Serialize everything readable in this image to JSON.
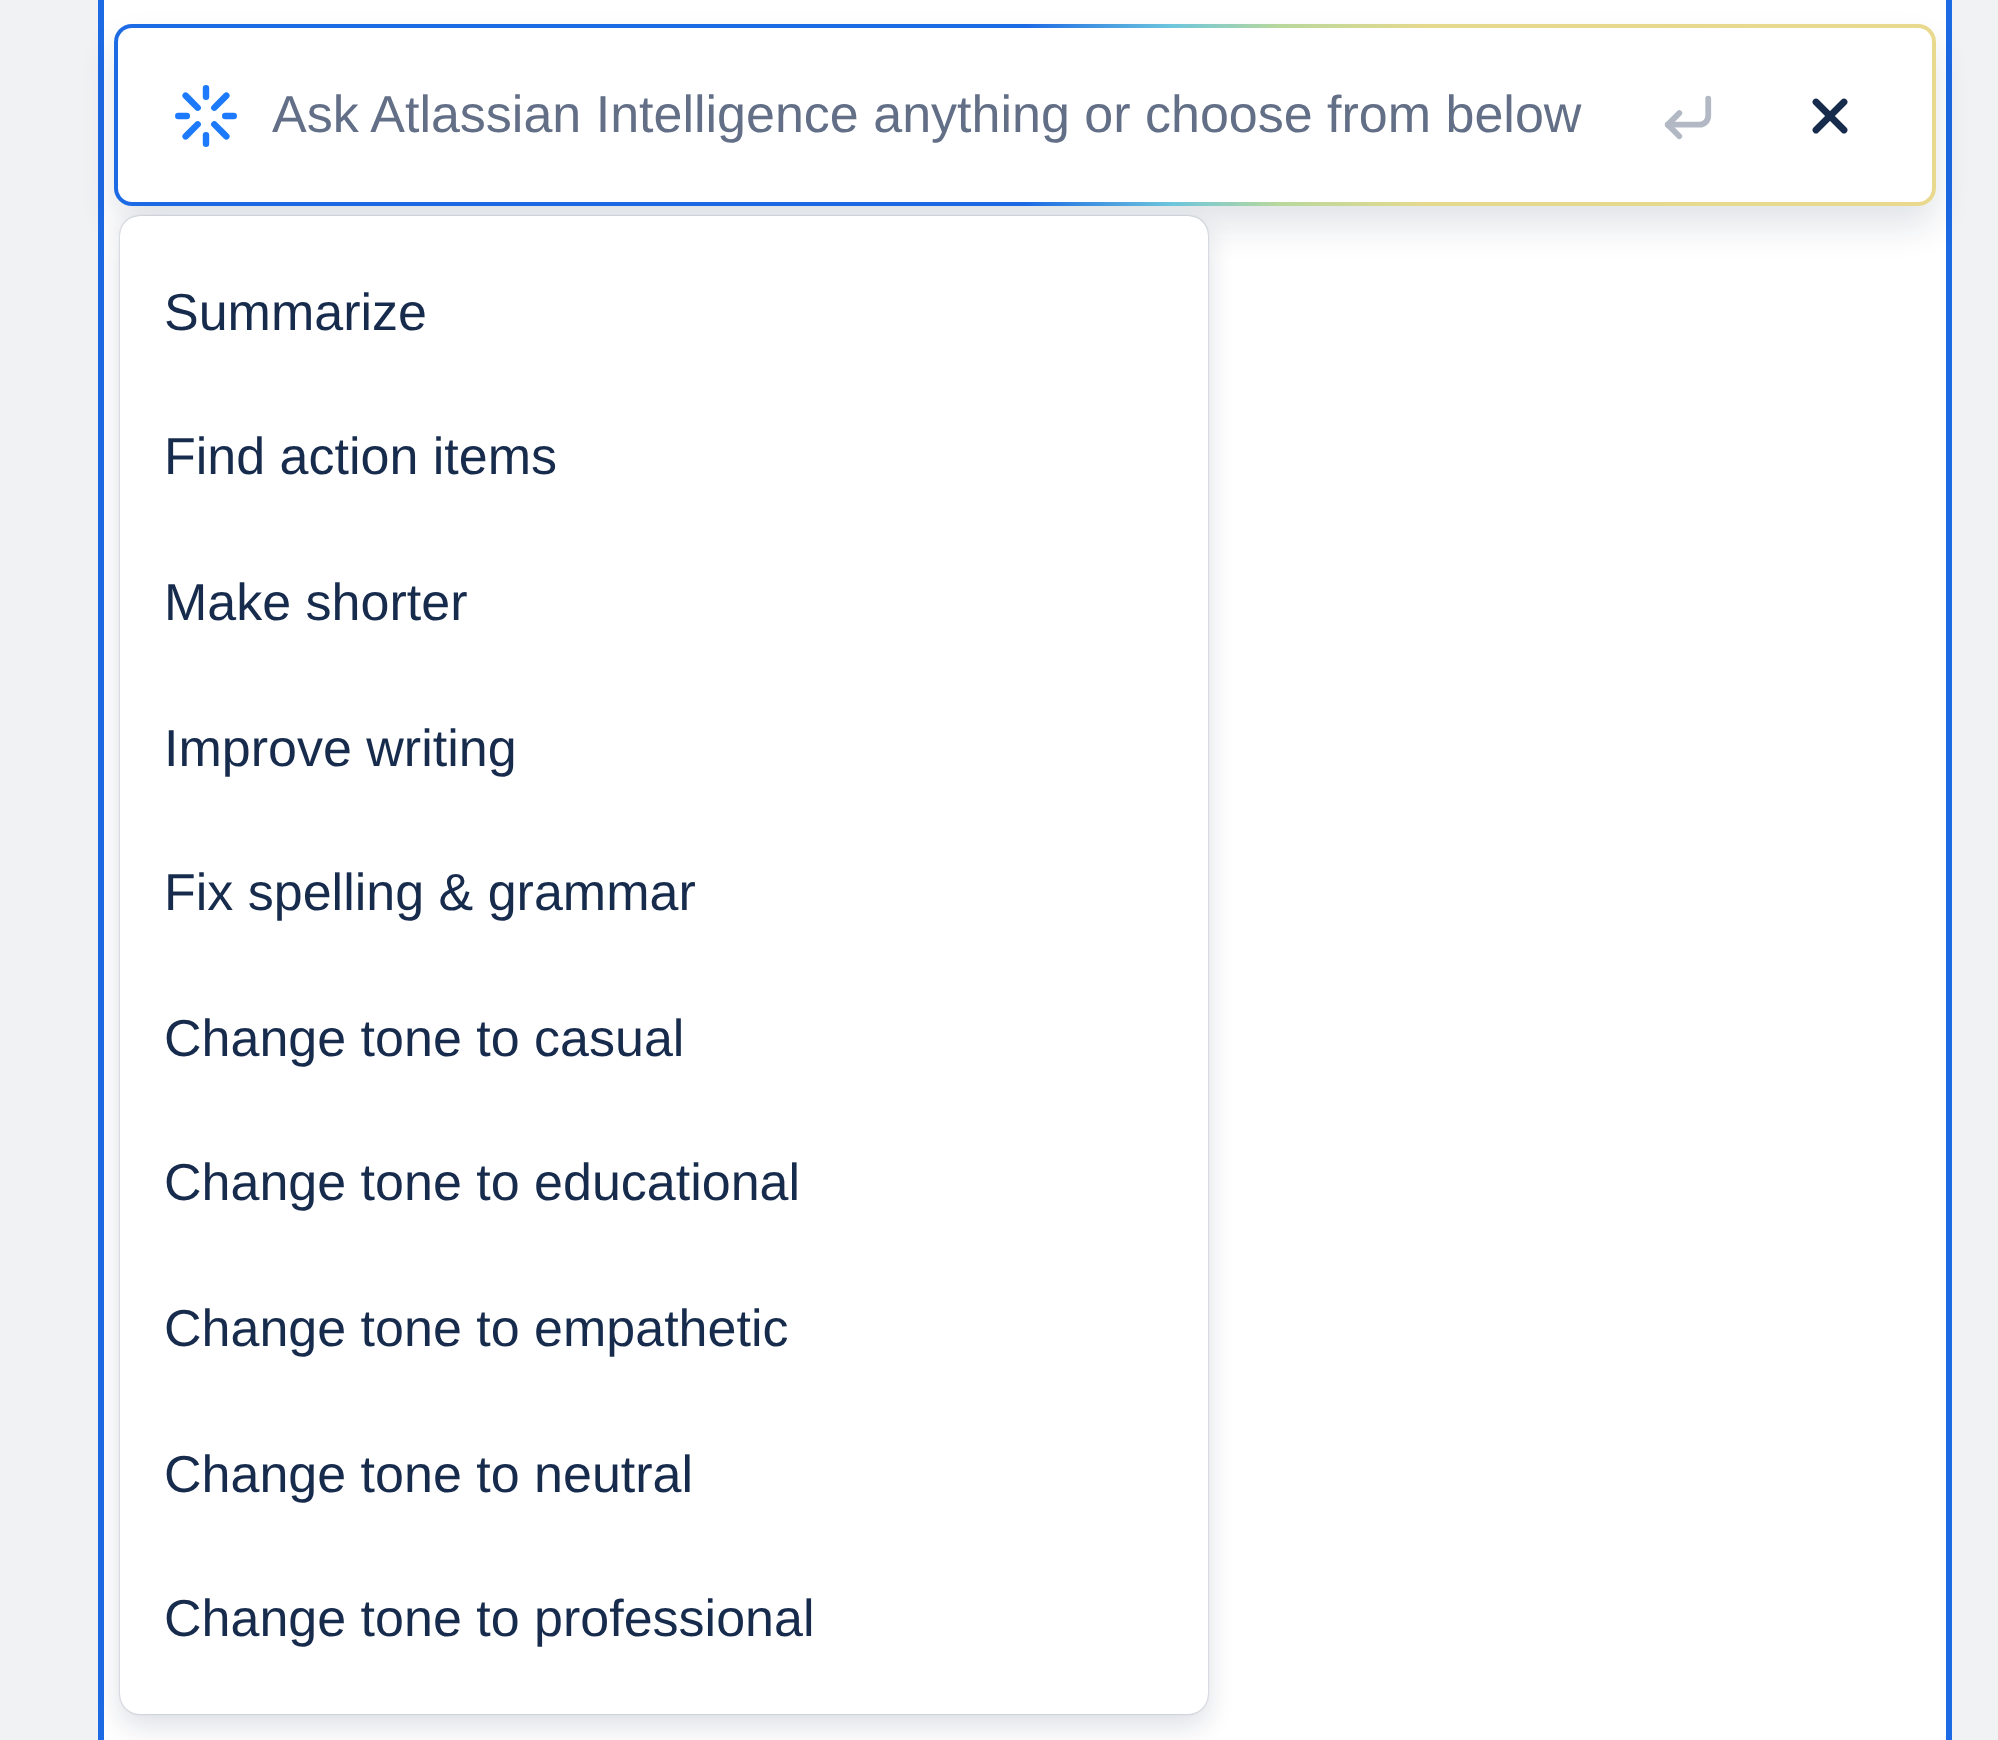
{
  "prompt": {
    "placeholder": "Ask Atlassian Intelligence anything or choose from below"
  },
  "suggestions": [
    {
      "label": "Summarize"
    },
    {
      "label": "Find action items"
    },
    {
      "label": "Make shorter"
    },
    {
      "label": "Improve writing"
    },
    {
      "label": "Fix spelling & grammar"
    },
    {
      "label": "Change tone to casual"
    },
    {
      "label": "Change tone to educational"
    },
    {
      "label": "Change tone to empathetic"
    },
    {
      "label": "Change tone to neutral"
    },
    {
      "label": "Change tone to professional"
    }
  ]
}
